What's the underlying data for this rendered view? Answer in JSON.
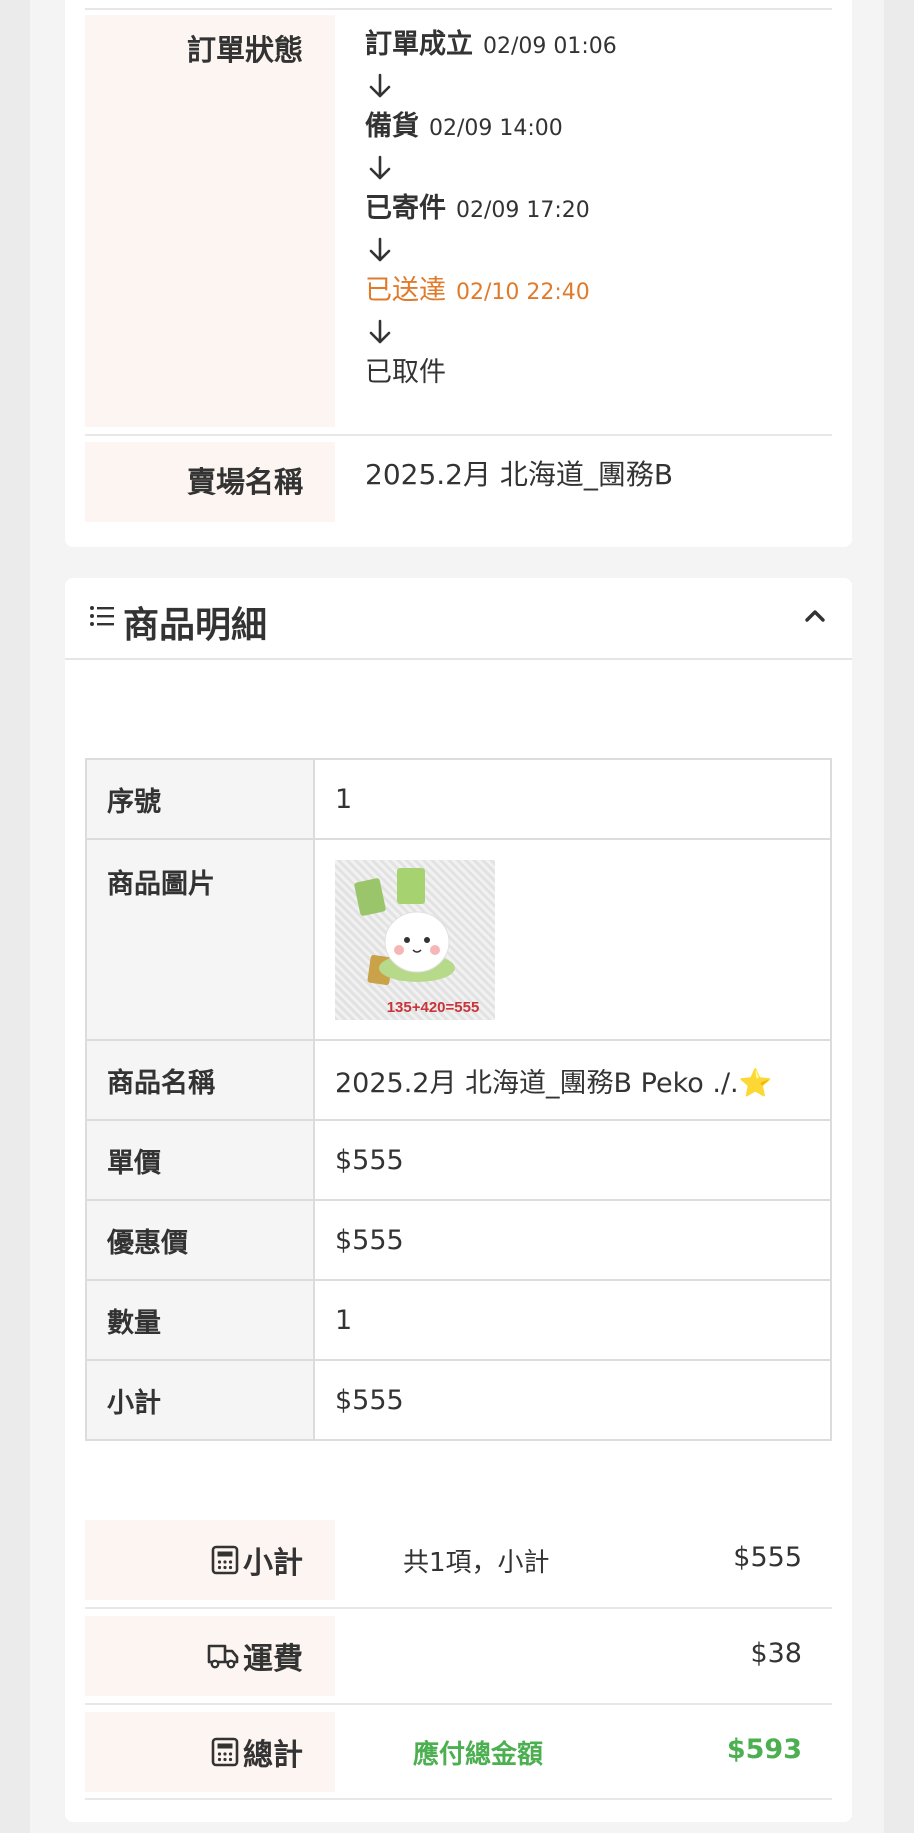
{
  "order_status": {
    "label": "訂單狀態",
    "steps": [
      {
        "name": "訂單成立",
        "time": "02/09 01:06"
      },
      {
        "name": "備貨",
        "time": "02/09 14:00"
      },
      {
        "name": "已寄件",
        "time": "02/09 17:20"
      },
      {
        "name": "已送達",
        "time": "02/10 22:40"
      },
      {
        "name": "已取件",
        "time": ""
      }
    ],
    "highlight_color": "#e07b2c"
  },
  "store": {
    "label": "賣場名稱",
    "value": "2025.2月 北海道_團務B"
  },
  "products": {
    "title": "商品明細",
    "list_icon": "list-icon",
    "toggle_icon": "chevron-up-icon",
    "rows": {
      "seq": {
        "label": "序號",
        "value": "1"
      },
      "image": {
        "label": "商品圖片",
        "caption": "135+420=555"
      },
      "name": {
        "label": "商品名稱",
        "value": "2025.2月 北海道_團務B Peko ./.⭐"
      },
      "unit_price": {
        "label": "單價",
        "value": "$555"
      },
      "discount_price": {
        "label": "優惠價",
        "value": "$555"
      },
      "quantity": {
        "label": "數量",
        "value": "1"
      },
      "subtotal": {
        "label": "小計",
        "value": "$555"
      }
    }
  },
  "summary": {
    "subtotal": {
      "label": "小計",
      "desc": "共1項，小計",
      "amount": "$555",
      "icon": "calculator-icon"
    },
    "shipping": {
      "label": "運費",
      "desc": "",
      "amount": "$38",
      "icon": "truck-icon"
    },
    "total": {
      "label": "總計",
      "desc": "應付總金額",
      "amount": "$593",
      "icon": "calculator-icon"
    },
    "total_color": "#4caf50"
  }
}
